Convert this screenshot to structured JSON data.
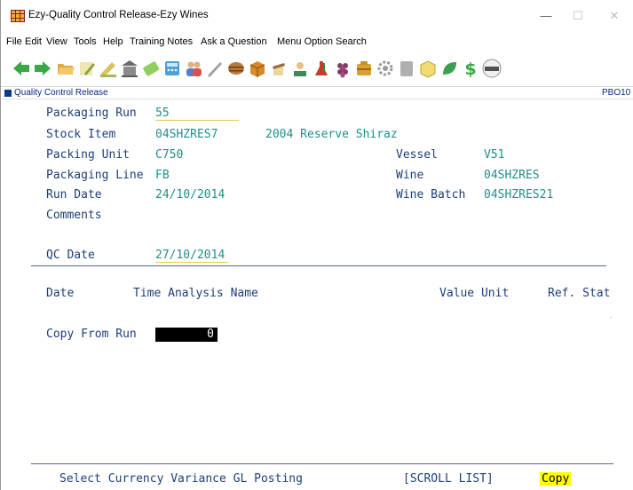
{
  "window": {
    "title": "Ezy-Quality Control Release-Ezy Wines",
    "controls": {
      "minimize": "—",
      "maximize": "☐",
      "close": "✕"
    }
  },
  "menu": {
    "items": [
      "File",
      "Edit",
      "View",
      "Tools",
      "Help",
      "Training Notes",
      "Ask a Question",
      "Menu Option Search"
    ]
  },
  "toolbar": {
    "icons": [
      {
        "name": "back-arrow-icon",
        "color": "#3aa845"
      },
      {
        "name": "forward-arrow-icon",
        "color": "#3aa845"
      },
      {
        "name": "open-folder-icon",
        "color": "#e5a93a"
      },
      {
        "name": "edit-pencil-icon",
        "color": "#d9c35a"
      },
      {
        "name": "pen-icon",
        "color": "#8ab04a"
      },
      {
        "name": "building-icon",
        "color": "#7a7a7a"
      },
      {
        "name": "money-icon",
        "color": "#8fcf60"
      },
      {
        "name": "calculator-icon",
        "color": "#4aa0d8"
      },
      {
        "name": "users-icon",
        "color": "#5580c8"
      },
      {
        "name": "pencil-tool-icon",
        "color": "#a0a0a0"
      },
      {
        "name": "barrel-icon",
        "color": "#b87a3a"
      },
      {
        "name": "box-icon",
        "color": "#d88a2a"
      },
      {
        "name": "bottle-icon",
        "color": "#9a6a3a"
      },
      {
        "name": "scales-icon",
        "color": "#3a8a5a"
      },
      {
        "name": "flask-icon",
        "color": "#c83a2a"
      },
      {
        "name": "grapes-icon",
        "color": "#8a3a6a"
      },
      {
        "name": "crate-icon",
        "color": "#d8a030"
      },
      {
        "name": "gear-icon",
        "color": "#9a9a9a"
      },
      {
        "name": "document-icon",
        "color": "#b0b0b0"
      },
      {
        "name": "package-icon",
        "color": "#e0c040"
      },
      {
        "name": "leaf-icon",
        "color": "#3aa050"
      },
      {
        "name": "dollar-icon",
        "color": "#3aa845"
      },
      {
        "name": "news-icon",
        "color": "#505050"
      }
    ]
  },
  "strip": {
    "label": "Quality Control Release",
    "code": "PBO10"
  },
  "form": {
    "packaging_run_label": "Packaging Run",
    "packaging_run_value": "55",
    "stock_item_label": "Stock Item",
    "stock_item_code": "04SHZRES7",
    "stock_item_desc": "2004 Reserve Shiraz",
    "packing_unit_label": "Packing Unit",
    "packing_unit_value": "C750",
    "packaging_line_label": "Packaging Line",
    "packaging_line_value": "FB",
    "run_date_label": "Run Date",
    "run_date_value": "24/10/2014",
    "comments_label": "Comments",
    "vessel_label": "Vessel",
    "vessel_value": "V51",
    "wine_label": "Wine",
    "wine_value": "04SHZRES",
    "wine_batch_label": "Wine Batch",
    "wine_batch_value": "04SHZRES21",
    "qc_date_label": "QC Date",
    "qc_date_value": "27/10/2014"
  },
  "table": {
    "headers": {
      "date": "Date",
      "time_analysis": "Time Analysis Name",
      "value_unit": "Value Unit",
      "ref_stat": "Ref. Stat"
    }
  },
  "copy_from_run": {
    "label": "Copy From Run",
    "value": "0"
  },
  "footer": {
    "hint": "Select Currency Variance GL Posting",
    "scroll_list": "[SCROLL LIST]",
    "copy": "Copy",
    "copy_highlight": "#ffff00"
  }
}
